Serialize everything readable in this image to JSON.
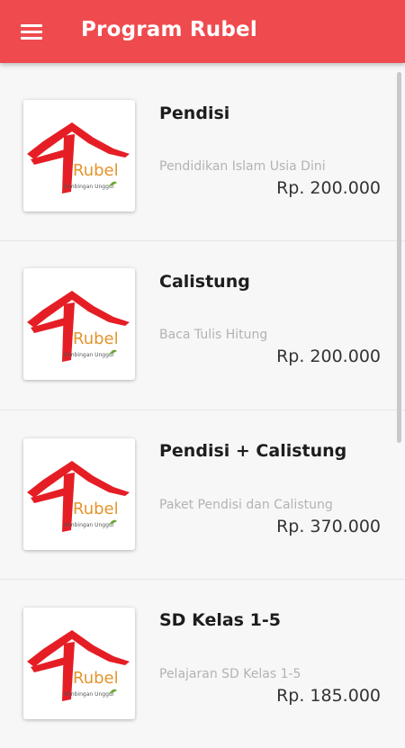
{
  "appbar": {
    "title": "Program Rubel",
    "menu_icon": "hamburger-menu-icon",
    "color": "#ef4b4f"
  },
  "logo": {
    "text": "Rubel",
    "tagline": "Bimbingan Unggul"
  },
  "programs": [
    {
      "title": "Pendisi",
      "description": "Pendidikan Islam Usia Dini",
      "price": "Rp. 200.000"
    },
    {
      "title": "Calistung",
      "description": "Baca Tulis Hitung",
      "price": "Rp. 200.000"
    },
    {
      "title": "Pendisi + Calistung",
      "description": "Paket Pendisi dan Calistung",
      "price": "Rp. 370.000"
    },
    {
      "title": "SD Kelas 1-5",
      "description": "Pelajaran SD Kelas 1-5",
      "price": "Rp. 185.000"
    }
  ]
}
